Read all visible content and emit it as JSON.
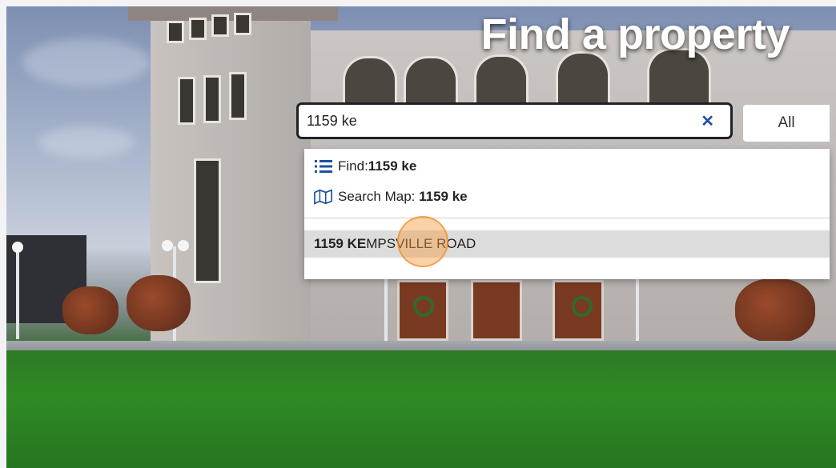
{
  "page": {
    "title": "Find a property"
  },
  "search": {
    "value": "1159 ke",
    "clear_icon": "close-icon",
    "scope": "All"
  },
  "dropdown": {
    "find_label": "Find: ",
    "find_value": "1159 ke",
    "find_icon": "list-icon",
    "map_label": "Search Map: ",
    "map_value": "1159 ke",
    "map_icon": "map-icon",
    "suggestion_match": "1159 KE",
    "suggestion_rest": "MPSVILLE ROAD"
  },
  "colors": {
    "accent": "#1f4fa0",
    "highlight": "#dcdcdc",
    "click_indicator": "#f69b3c"
  }
}
